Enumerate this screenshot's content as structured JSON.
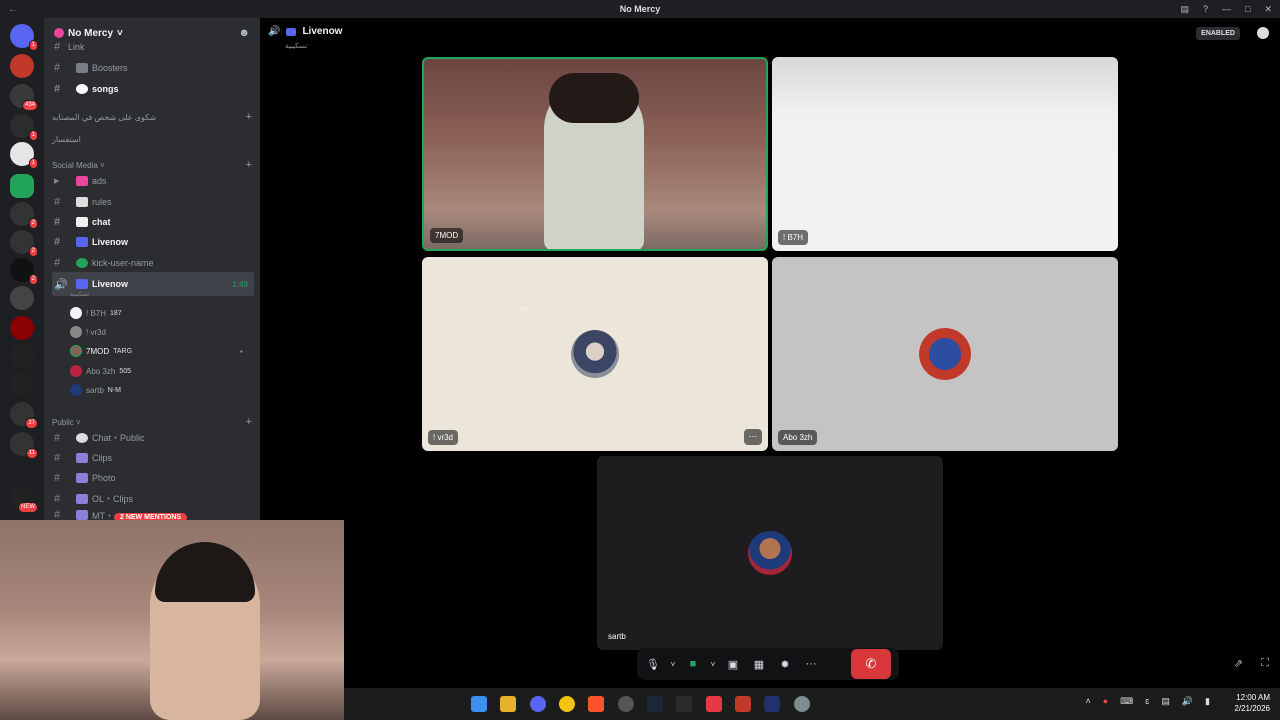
{
  "window": {
    "title": "No Mercy",
    "enabled_badge": "ENABLED"
  },
  "server": {
    "name": "No Mercy"
  },
  "server_rail": [
    {
      "badge": "1",
      "color": "#5865f2"
    },
    {
      "badge": "",
      "color": "#c0392b"
    },
    {
      "badge": "434",
      "color": "#3a3a3a"
    },
    {
      "badge": "1",
      "color": "#2c2c2c"
    },
    {
      "badge": "1",
      "color": "#e6e6e6"
    },
    {
      "badge": "",
      "color": "#23a559"
    },
    {
      "badge": "2",
      "color": "#333"
    },
    {
      "badge": "2",
      "color": "#333"
    },
    {
      "badge": "2",
      "color": "#111"
    },
    {
      "badge": "",
      "color": "#444"
    },
    {
      "badge": "",
      "color": "#8b0000"
    },
    {
      "badge": "",
      "color": "#222"
    },
    {
      "badge": "",
      "color": "#222"
    },
    {
      "badge": "27",
      "color": "#333"
    },
    {
      "badge": "11",
      "color": "#333"
    },
    {
      "badge": "",
      "color": "#222"
    },
    {
      "badge": "NEW",
      "color": "#222"
    }
  ],
  "channels": {
    "link": "Link",
    "boosters": "Boosters",
    "songs": "songs",
    "cat_complaint": "شكوى على شخص في المصنابه",
    "cat_forms": "استفسار",
    "cat_social": "Social Media",
    "ads": "ads",
    "rules": "rules",
    "chat": "chat",
    "livenow": "Livenow",
    "kick": "kick-user-name",
    "live_active": "Livenow",
    "live_time": "1:49",
    "live_sub": "تسكيبية",
    "cat_public": "Public",
    "chat_public": "Chat・Public",
    "clips": "Clips",
    "photo": "Photo",
    "ol_clips": "OL・Clips",
    "mt": "MT・"
  },
  "voice_users": [
    {
      "name": "! B7H",
      "tag": "187"
    },
    {
      "name": "! vr3d",
      "tag": ""
    },
    {
      "name": "7MOD",
      "tag": "TARG"
    },
    {
      "name": "Abo 3zh",
      "tag": "505"
    },
    {
      "name": "sartb",
      "tag": "N-M"
    }
  ],
  "mentions": "2 NEW MENTIONS",
  "call": {
    "channel": "Livenow",
    "subtitle": "تسكيبية",
    "tiles": [
      "7MOD",
      "! B7H",
      "! vr3d",
      "Abo 3zh",
      "sartb"
    ]
  },
  "controls": {
    "mic": "mic-icon",
    "camera": "camera-icon",
    "more": "···"
  },
  "taskbar": {
    "time": "12:00 AM",
    "date": "2/21/2026"
  },
  "colors": {
    "accent": "#5865f2",
    "danger": "#da373c",
    "online": "#23a559"
  }
}
